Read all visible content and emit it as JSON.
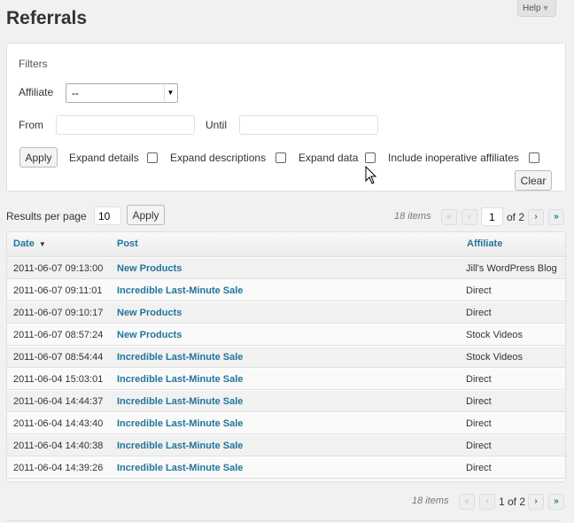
{
  "page": {
    "title": "Referrals",
    "help_label": "Help"
  },
  "filters": {
    "title": "Filters",
    "affiliate_label": "Affiliate",
    "affiliate_value": "--",
    "from_label": "From",
    "until_label": "Until",
    "apply_label": "Apply",
    "clear_label": "Clear",
    "expand_details_label": "Expand details",
    "expand_descriptions_label": "Expand descriptions",
    "expand_data_label": "Expand data",
    "include_inoperative_label": "Include inoperative affiliates"
  },
  "results": {
    "per_page_label": "Results per page",
    "per_page_value": "10",
    "apply_label": "Apply"
  },
  "pagination": {
    "items_label": "18 items",
    "current_page": "1",
    "of_label": "of 2",
    "bottom_text": "1 of 2",
    "first": "«",
    "prev": "‹",
    "next": "›",
    "last": "»"
  },
  "table": {
    "columns": [
      "Date",
      "Post",
      "Affiliate"
    ],
    "sort_icon": "sort-down-icon",
    "rows": [
      {
        "date": "2011-06-07 09:13:00",
        "post": "New Products",
        "affiliate": "Jill's WordPress Blog"
      },
      {
        "date": "2011-06-07 09:11:01",
        "post": "Incredible Last-Minute Sale",
        "affiliate": "Direct"
      },
      {
        "date": "2011-06-07 09:10:17",
        "post": "New Products",
        "affiliate": "Direct"
      },
      {
        "date": "2011-06-07 08:57:24",
        "post": "New Products",
        "affiliate": "Stock Videos"
      },
      {
        "date": "2011-06-07 08:54:44",
        "post": "Incredible Last-Minute Sale",
        "affiliate": "Stock Videos"
      },
      {
        "date": "2011-06-04 15:03:01",
        "post": "Incredible Last-Minute Sale",
        "affiliate": "Direct"
      },
      {
        "date": "2011-06-04 14:44:37",
        "post": "Incredible Last-Minute Sale",
        "affiliate": "Direct"
      },
      {
        "date": "2011-06-04 14:43:40",
        "post": "Incredible Last-Minute Sale",
        "affiliate": "Direct"
      },
      {
        "date": "2011-06-04 14:40:38",
        "post": "Incredible Last-Minute Sale",
        "affiliate": "Direct"
      },
      {
        "date": "2011-06-04 14:39:26",
        "post": "Incredible Last-Minute Sale",
        "affiliate": "Direct"
      }
    ]
  },
  "colors": {
    "link": "#21759b",
    "background": "#f1f1f1"
  }
}
